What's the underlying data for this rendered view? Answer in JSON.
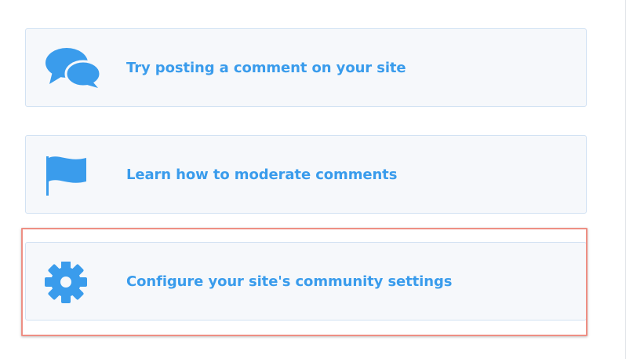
{
  "colors": {
    "accent": "#3a9cec",
    "card_background": "#f6f8fb",
    "card_border": "#d2e2f3",
    "highlight": "#ee8f84"
  },
  "cards": [
    {
      "label": "Try posting a comment on your site",
      "icon": "comments-icon"
    },
    {
      "label": "Learn how to moderate comments",
      "icon": "flag-icon"
    },
    {
      "label": "Configure your site's community settings",
      "icon": "gear-icon"
    }
  ]
}
